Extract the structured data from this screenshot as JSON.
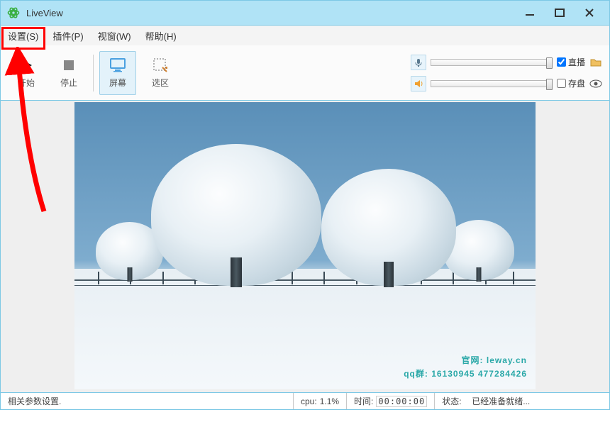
{
  "title": "LiveView",
  "menu": {
    "settings": "设置(S)",
    "plugins": "插件(P)",
    "window": "视窗(W)",
    "help": "帮助(H)"
  },
  "toolbar": {
    "start": "开始",
    "stop": "停止",
    "screen": "屏幕",
    "region": "选区"
  },
  "right": {
    "live": "直播",
    "save": "存盘"
  },
  "watermark": {
    "site_label": "官网:",
    "site": "leway.cn",
    "qq_label": "qq群:",
    "qq": "16130945 477284426"
  },
  "status": {
    "left": "相关参数设置.",
    "cpu_label": "cpu:",
    "cpu_value": "1.1%",
    "time_label": "时间:",
    "time_value": "00:00:00",
    "state_label": "状态:",
    "state_value": "已经准备就绪..."
  }
}
